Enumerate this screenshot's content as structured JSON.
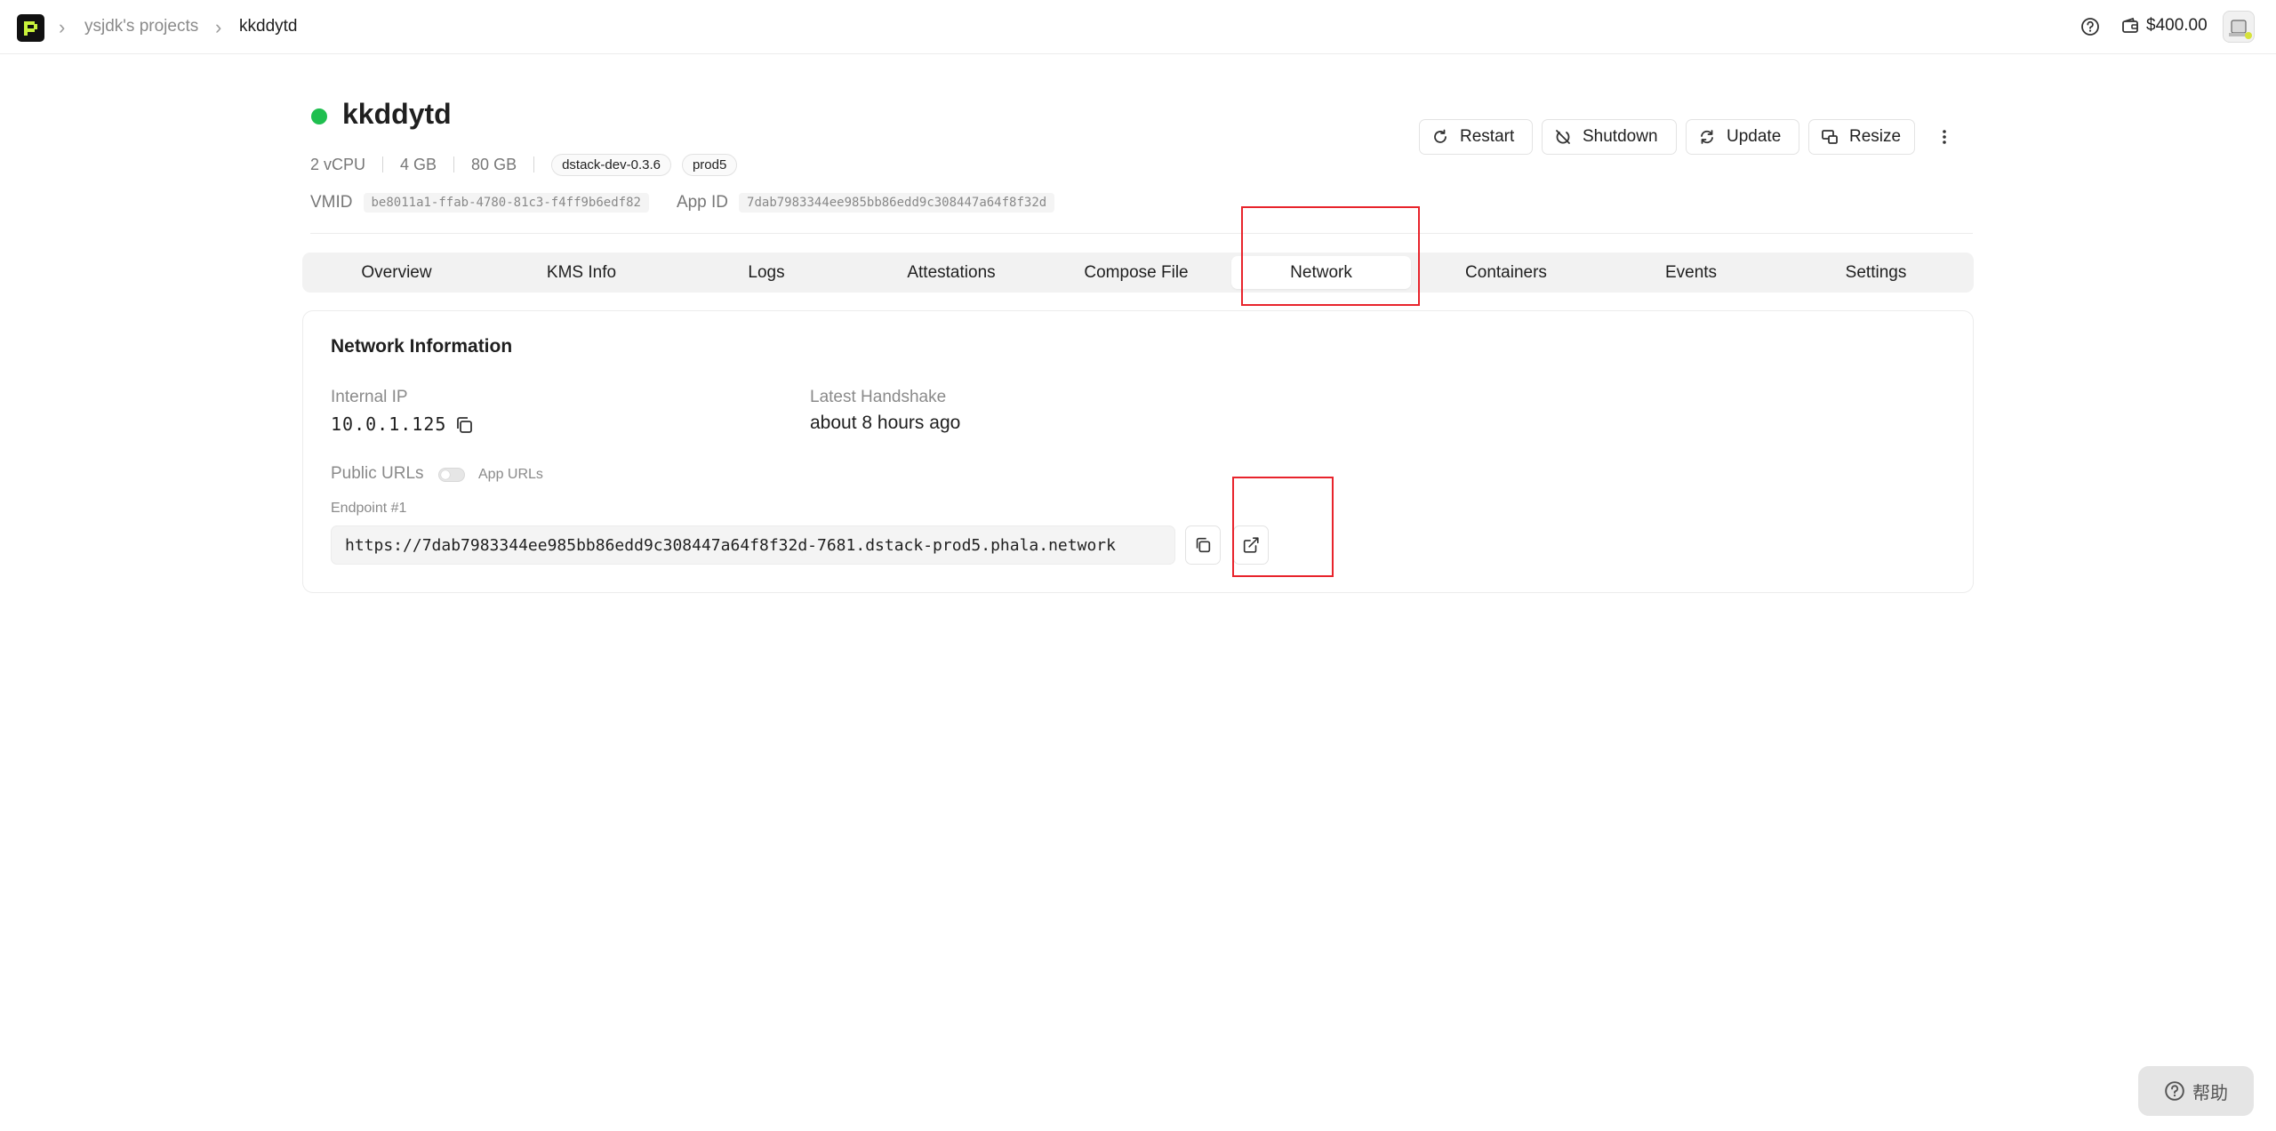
{
  "topbar": {
    "breadcrumb": [
      "ysjdk's projects",
      "kkddytd"
    ],
    "balance": "$400.00"
  },
  "header": {
    "status": "running",
    "status_color": "#1fbf4f",
    "title": "kkddytd",
    "specs": [
      "2 vCPU",
      "4 GB",
      "80 GB"
    ],
    "tags": [
      "dstack-dev-0.3.6",
      "prod5"
    ],
    "vmid_label": "VMID",
    "vmid": "be8011a1-ffab-4780-81c3-f4ff9b6edf82",
    "appid_label": "App ID",
    "appid": "7dab7983344ee985bb86edd9c308447a64f8f32d"
  },
  "actions": {
    "restart": "Restart",
    "shutdown": "Shutdown",
    "update": "Update",
    "resize": "Resize"
  },
  "tabs": [
    "Overview",
    "KMS Info",
    "Logs",
    "Attestations",
    "Compose File",
    "Network",
    "Containers",
    "Events",
    "Settings"
  ],
  "active_tab": "Network",
  "network": {
    "title": "Network Information",
    "internal_ip_label": "Internal IP",
    "internal_ip": "10.0.1.125",
    "handshake_label": "Latest Handshake",
    "handshake": "about 8 hours ago",
    "public_urls_label": "Public URLs",
    "app_urls_label": "App URLs",
    "app_urls_toggle": false,
    "endpoint_label": "Endpoint #1",
    "endpoint_url": "https://7dab7983344ee985bb86edd9c308447a64f8f32d-7681.dstack-prod5.phala.network"
  },
  "help_float": "帮助",
  "highlight_color": "#e8242c"
}
